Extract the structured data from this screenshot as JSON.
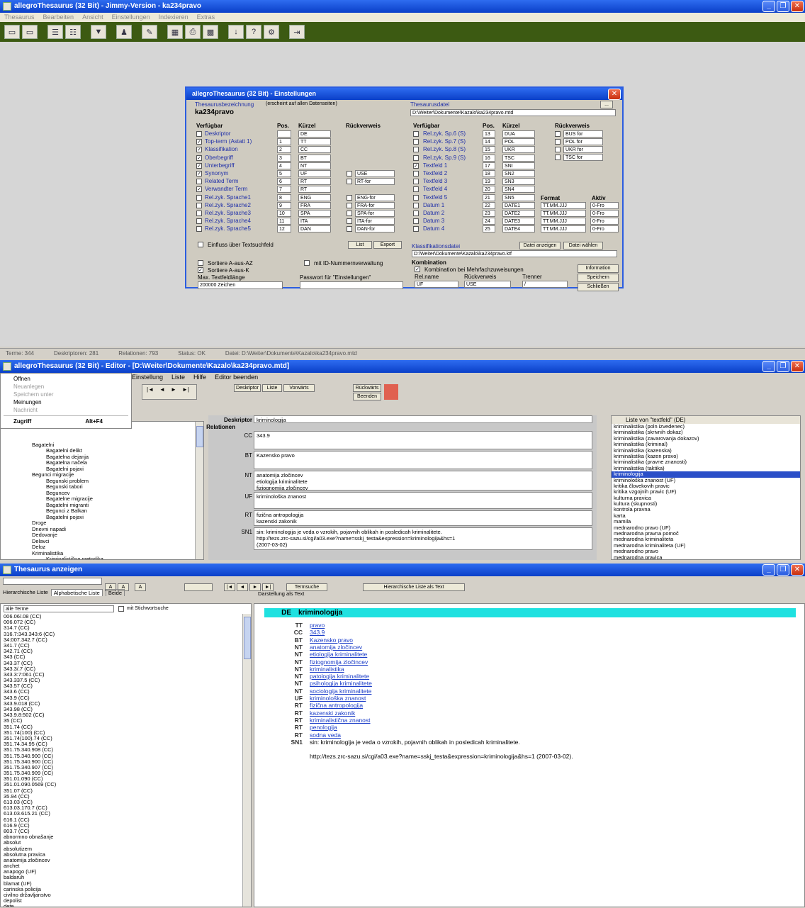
{
  "win1": {
    "title": "allegroThesaurus (32 Bit) - Jimmy-Version - ka234pravo",
    "menu": [
      "Thesaurus",
      "Bearbeiten",
      "Ansicht",
      "Einstellungen",
      "Indexieren",
      "Extras"
    ],
    "status": [
      "Terme: 344",
      "Deskriptoren: 281",
      "Relationen: 793",
      "Status: OK",
      "Datei: D:\\Weiter\\Dokumente\\Kazalo\\ka234pravo.mtd"
    ]
  },
  "dialog": {
    "title": "allegroThesaurus (32 Bit) - Einstellungen",
    "name_label": "Thesaurusbezeichnung",
    "name_hint": "(erscheint auf allen Datenseiten)",
    "name_value": "ka234pravo",
    "file_label": "Thesaurusdatei",
    "file_btn": "...",
    "file_value": "D:\\Weiter\\Dokumente\\Kazalo\\ka234pravo.mtd",
    "col_headers_left": [
      "Verfügbar",
      "Pos.",
      "Kürzel",
      "Rückverweis"
    ],
    "col_headers_right": [
      "Verfügbar",
      "Pos.",
      "Kürzel",
      "Rückverweis"
    ],
    "left_rows": [
      {
        "label": "Deskriptor",
        "pos": "",
        "code": "DE",
        "back": "",
        "checked": false
      },
      {
        "label": "Top-term (Astatt 1)",
        "pos": "1",
        "code": "TT",
        "back": "",
        "checked": true
      },
      {
        "label": "Klassifikation",
        "pos": "2",
        "code": "CC",
        "back": "",
        "checked": true
      },
      {
        "label": "Oberbegriff",
        "pos": "3",
        "code": "BT",
        "back": "",
        "checked": true
      },
      {
        "label": "Unterbegriff",
        "pos": "4",
        "code": "NT",
        "back": "",
        "checked": true
      },
      {
        "label": "Synonym",
        "pos": "5",
        "code": "UF",
        "back": "USE",
        "checked": true
      },
      {
        "label": "Related Term",
        "pos": "6",
        "code": "RT",
        "back": "RT-for",
        "checked": false
      },
      {
        "label": "Verwandter Term",
        "pos": "7",
        "code": "RT",
        "back": "",
        "checked": true
      },
      {
        "label": "Rel.zyk. Sprache1",
        "pos": "8",
        "code": "ENG",
        "back": "ENG-for",
        "checked": false
      },
      {
        "label": "Rel.zyk. Sprache2",
        "pos": "9",
        "code": "FRA",
        "back": "FRA-for",
        "checked": false
      },
      {
        "label": "Rel.zyk. Sprache3",
        "pos": "10",
        "code": "SPA",
        "back": "SPA-for",
        "checked": false
      },
      {
        "label": "Rel.zyk. Sprache4",
        "pos": "11",
        "code": "ITA",
        "back": "ITA-for",
        "checked": false
      },
      {
        "label": "Rel.zyk. Sprache5",
        "pos": "12",
        "code": "DAN",
        "back": "DAN-for",
        "checked": false
      }
    ],
    "right_rows": [
      {
        "label": "Rel.zyk. Sp.6 (S)",
        "pos": "13",
        "code": "DUA",
        "checked": false
      },
      {
        "label": "Rel.zyk. Sp.7 (S)",
        "pos": "14",
        "code": "POL",
        "checked": false
      },
      {
        "label": "Rel.zyk. Sp.8 (S)",
        "pos": "15",
        "code": "UKR",
        "checked": false
      },
      {
        "label": "Rel.zyk. Sp.9 (S)",
        "pos": "16",
        "code": "TSC",
        "checked": false
      },
      {
        "label": "Textfeld 1",
        "pos": "17",
        "code": "SNI",
        "checked": true
      },
      {
        "label": "Textfeld 2",
        "pos": "18",
        "code": "SN2",
        "checked": false
      },
      {
        "label": "Textfeld 3",
        "pos": "19",
        "code": "SN3",
        "checked": false
      },
      {
        "label": "Textfeld 4",
        "pos": "20",
        "code": "SN4",
        "checked": false
      },
      {
        "label": "Textfeld 5",
        "pos": "21",
        "code": "SN5",
        "checked": false
      },
      {
        "label": "Datum 1",
        "pos": "22",
        "code": "DATE1",
        "checked": false
      },
      {
        "label": "Datum 2",
        "pos": "23",
        "code": "DATE2",
        "checked": false
      },
      {
        "label": "Datum 3",
        "pos": "24",
        "code": "DATE3",
        "checked": false
      },
      {
        "label": "Datum 4",
        "pos": "25",
        "code": "DATE4",
        "checked": false
      }
    ],
    "back_right_header": "Rückverweis",
    "back_right": [
      "BUS for",
      "POL for",
      "UKR for",
      "TSC for"
    ],
    "format_header": "Format",
    "aktiv_header": "Aktiv",
    "format_values": [
      "TT.MM.JJJ",
      "TT.MM.JJJ",
      "TT.MM.JJJ",
      "TT.MM.JJJ"
    ],
    "aktiv_values": [
      "0-Fro",
      "0-Fro",
      "0-Fro",
      "0-Fro"
    ],
    "cb_label": "Einfluss über Textsuchfeld",
    "btn_list": "List",
    "btn_export": "Export",
    "cb_sort_az": "Sortiere A-aus-AZ",
    "cb_sort_ak": "Sortiere A-aus-K",
    "cb_id": "mit ID-Nummernverwaltung",
    "max_len_label": "Max. Textfeldlänge",
    "max_len_value": "200000 Zeichen",
    "pwd_label": "Passwort für \"Einstellungen\"",
    "class_label": "Klassifikationsdatei",
    "class_btn1": "Datei anzeigen",
    "class_btn2": "Datei wählen",
    "class_value": "D:\\Weiter\\Dokumente\\Kazalo\\ka234pravo.ktf",
    "combo_header": "Kombination",
    "combo_cb": "Kombination bei Mehrfachzuweisungen",
    "combo_cols": [
      "Rel.name",
      "Rückverweis",
      "Trenner"
    ],
    "combo_vals": [
      "UF",
      "USE",
      "/"
    ],
    "btn_info": "Information",
    "btn_save": "Speichern",
    "btn_close": "Schließen"
  },
  "win2": {
    "title": "allegroThesaurus (32 Bit) - Editor - [D:\\Weiter\\Dokumente\\Kazalo\\ka234pravo.mtd]",
    "menu": [
      "Einstellung",
      "Liste",
      "Hilfe",
      "Editor beenden"
    ],
    "dropdown": [
      {
        "label": "Öffnen",
        "disabled": false
      },
      {
        "label": "Neuanlegen",
        "disabled": true
      },
      {
        "label": "Speichern unter",
        "disabled": true
      },
      {
        "label": "Meinungen",
        "disabled": false
      },
      {
        "label": "Nachricht",
        "disabled": true
      },
      {
        "label": "Zugriff",
        "disabled": false,
        "shortcut": "Alt+F4"
      }
    ],
    "nav_btns": [
      "Deskriptor",
      "Liste",
      "Vorwärts",
      "Rückwärts",
      "Beenden"
    ],
    "desc_label": "Deskriptor",
    "desc_value": "kriminologija",
    "rel_label": "Relationen",
    "fields": [
      {
        "label": "CC",
        "value": "343.9"
      },
      {
        "label": "BT",
        "value": "Kazensko pravo"
      },
      {
        "label": "NT",
        "value": "anatomija zločincev\netiologija kriminalitete\nfiziognomija zločincev"
      },
      {
        "label": "UF",
        "value": "kriminološka znanost"
      },
      {
        "label": "RT",
        "value": "fizična antropologija\nkazenski zakonik\nkriminalistična znanost"
      },
      {
        "label": "SN1",
        "value": "sin: kriminologija je veda o vzrokih, pojavnih oblikah in posledicah kriminalitete.\nhttp://tezs.zrc-sazu.si/cgi/a03.exe?name=sskj_testa&expression=kriminologija&hs=1\n(2007-03-02)"
      }
    ],
    "tree_root": "Odprta datoteka",
    "tree": [
      {
        "label": "Bagatelni",
        "level": 1
      },
      {
        "label": "Bagatelni delikt",
        "level": 2
      },
      {
        "label": "Bagatelna dejanja",
        "level": 2
      },
      {
        "label": "Bagatelna načela",
        "level": 2
      },
      {
        "label": "Bagatelni pojavi",
        "level": 2
      },
      {
        "label": "Begunci migracije",
        "level": 1
      },
      {
        "label": "Begunski problem",
        "level": 2
      },
      {
        "label": "Begunski tabori",
        "level": 2
      },
      {
        "label": "Beguncev",
        "level": 2
      },
      {
        "label": "Bagatelne migracije",
        "level": 2
      },
      {
        "label": "Bagatelni migranti",
        "level": 2
      },
      {
        "label": "Begunci z Balkan",
        "level": 2
      },
      {
        "label": "Bagatelni pojavi",
        "level": 2
      },
      {
        "label": "Droge",
        "level": 1
      },
      {
        "label": "Dnevni napadi",
        "level": 1
      },
      {
        "label": "Dedovanje",
        "level": 1
      },
      {
        "label": "Delavci",
        "level": 1
      },
      {
        "label": "Deloz",
        "level": 1
      },
      {
        "label": "Kriminalistika",
        "level": 1
      },
      {
        "label": "Kriminalistična metodika",
        "level": 2
      },
      {
        "label": "Kriminalistična taktika",
        "level": 3
      },
      {
        "label": "Kriminalistična tehnika",
        "level": 2
      }
    ],
    "list_header": "Liste von \"textfeld\" (DE)",
    "list": [
      "kriminalistika (poln izvedenec)",
      "kriminalistika (skrivnih dokaz)",
      "kriminalistika (zavarovanja dokazov)",
      "kriminalistika (kriminal)",
      "kriminalistika (kazenska)",
      "kriminalistika (kazen pravo)",
      "kriminalistika (pravne znanosti)",
      "kriminalistika (taktika)",
      "kriminologija",
      "kriminološka znanost (UF)",
      "kritika človekovih pravic",
      "kritika vzgojnih pravic (UF)",
      "kulturna pravica",
      "kultura (skupnosti)",
      "kontrola pravna",
      "karta",
      "mamila",
      "mednarodno pravo (UF)",
      "mednarodna pravna pomoč",
      "mednarodna kriminaliteta",
      "mednarodna kriminaliteta (UF)",
      "mednarodno pravo",
      "mednarodna pravica",
      "mednarodna kriminaliteta",
      "megalomanija"
    ]
  },
  "win3": {
    "title": "Thesaurus anzeigen",
    "toolbar": [
      "Termsuche",
      "Hierarchische Liste als Text"
    ],
    "tabs": [
      "Hierarchische Liste",
      "Alphabetische Liste",
      "Beide"
    ],
    "filter_value": "alle Terme",
    "filter_cb": "mit Stichwortsuche",
    "preview_label": "Darstellung als Text",
    "list": [
      "006.06/.08  (CC)",
      "006.072  (CC)",
      "314.7  (CC)",
      "316.7:343.343:6  (CC)",
      "34:007.342.7  (CC)",
      "341.7  (CC)",
      "342.71  (CC)",
      "343  (CC)",
      "343.37  (CC)",
      "343.3/.7  (CC)",
      "343.3:7:061  (CC)",
      "343.337.5  (CC)",
      "343.57  (CC)",
      "343.6  (CC)",
      "343.9  (CC)",
      "343.9.018  (CC)",
      "343.98  (CC)",
      "343.9.8:502  (CC)",
      "35  (CC)",
      "351.74  (CC)",
      "351.74(100)  (CC)",
      "351.74(100).74  (CC)",
      "351.74.34.95  (CC)",
      "351.75.340.908  (CC)",
      "351.75.340.900  (CC)",
      "351.75.340.900  (CC)",
      "351.75.340.907  (CC)",
      "351.75.340.909  (CC)",
      "351.01.090  (CC)",
      "351.01.090.0569  (CC)",
      "351.07  (CC)",
      "35.94  (CC)",
      "613.03  (CC)",
      "613.03.170.7  (CC)",
      "613.03.615.21  (CC)",
      "616.1  (CC)",
      "616.9  (CC)",
      "803.7  (CC)",
      "abnormno obnašanje",
      "absolut",
      "absolutizem",
      "absolutna pravica",
      "anatomija zločincev",
      "anchet",
      "anapogo (UF)",
      "baldaruh",
      "blamat (UF)",
      "carinska policija",
      "civilno državljanstvo",
      "depolist",
      "dete",
      "detonija zakonodaja"
    ],
    "de_code": "DE",
    "de_value": "kriminologija",
    "relations": [
      {
        "code": "TT",
        "text": "pravo",
        "link": true
      },
      {
        "code": "CC",
        "text": "343.9",
        "link": true
      },
      {
        "code": "BT",
        "text": "Kazensko pravo",
        "link": true
      },
      {
        "code": "NT",
        "text": "anatomija zločincev",
        "link": true
      },
      {
        "code": "NT",
        "text": "etiologija kriminalitete",
        "link": true
      },
      {
        "code": "NT",
        "text": "fiziognomija zločincev",
        "link": true
      },
      {
        "code": "NT",
        "text": "kriminalistika",
        "link": true
      },
      {
        "code": "NT",
        "text": "patologija kriminalitete",
        "link": true
      },
      {
        "code": "NT",
        "text": "psihologija kriminalitete",
        "link": true
      },
      {
        "code": "NT",
        "text": "sociologija kriminalitete",
        "link": true
      },
      {
        "code": "UF",
        "text": "kriminološka znanost",
        "link": true
      },
      {
        "code": "RT",
        "text": "fizična antropologija",
        "link": true
      },
      {
        "code": "RT",
        "text": "kazenski zakonik",
        "link": true
      },
      {
        "code": "RT",
        "text": "kriminalistična znanost",
        "link": true
      },
      {
        "code": "RT",
        "text": "penologija",
        "link": true
      },
      {
        "code": "RT",
        "text": "sodna veda",
        "link": true
      },
      {
        "code": "SN1",
        "text": "sin: kriminologija je veda o vzrokih, pojavnih oblikah in posledicah kriminalitete.",
        "link": false
      }
    ],
    "sn_url": "http://tezs.zrc-sazu.si/cgi/a03.exe?name=sskj_testa&expression=kriminologija&hs=1 (2007-03-02)."
  }
}
